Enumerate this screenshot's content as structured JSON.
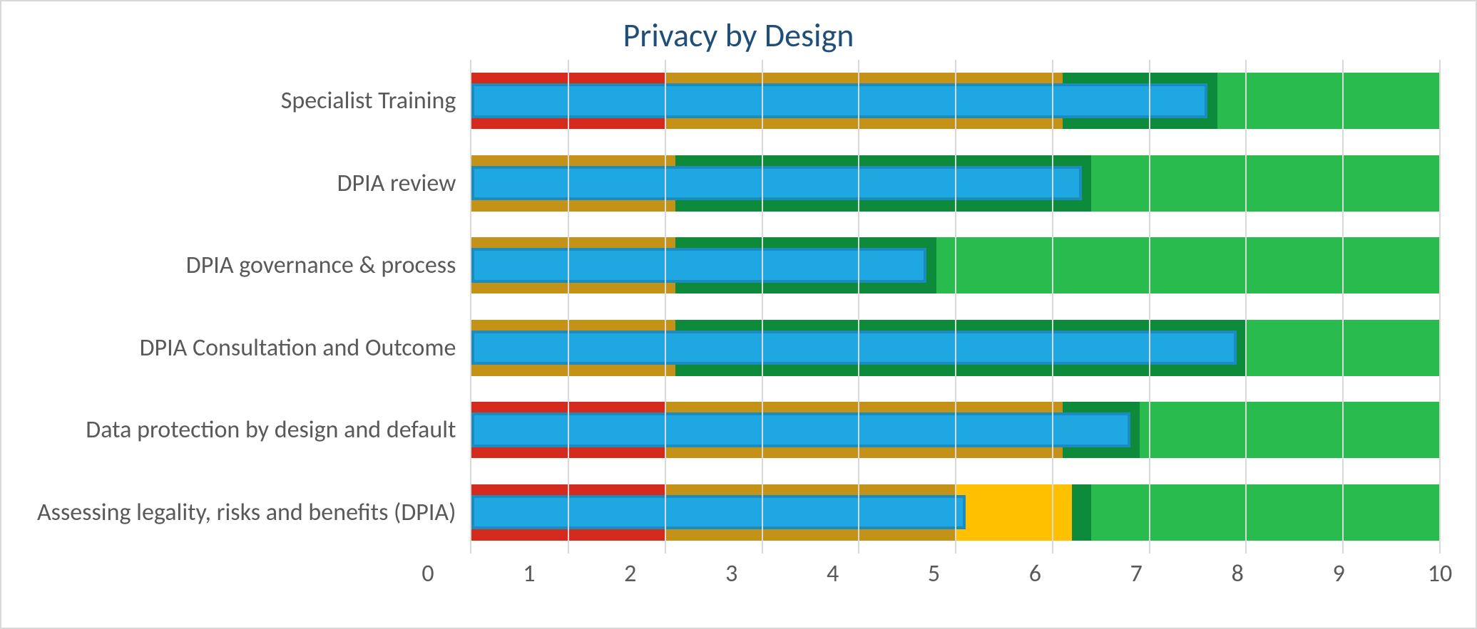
{
  "chart_data": {
    "type": "bar",
    "orientation": "horizontal",
    "title": "Privacy by Design",
    "xlabel": "",
    "ylabel": "",
    "xlim": [
      0,
      10
    ],
    "x_ticks": [
      0,
      1,
      2,
      3,
      4,
      5,
      6,
      7,
      8,
      9,
      10
    ],
    "categories": [
      "Specialist Training",
      "DPIA review",
      "DPIA governance & process",
      "DPIA Consultation and Outcome",
      "Data protection by design and default",
      "Assessing  legality, risks and benefits (DPIA)"
    ],
    "series": [
      {
        "name": "score",
        "values": [
          7.6,
          6.3,
          4.7,
          7.9,
          6.8,
          5.1
        ]
      },
      {
        "name": "zone_red_end",
        "values": [
          2.0,
          0.0,
          0.0,
          0.0,
          2.0,
          2.0
        ]
      },
      {
        "name": "zone_gold_end",
        "values": [
          6.1,
          2.1,
          2.1,
          2.1,
          6.1,
          5.0
        ]
      },
      {
        "name": "zone_yellow_end",
        "values": [
          6.1,
          2.1,
          2.1,
          2.1,
          6.1,
          6.2
        ]
      },
      {
        "name": "zone_dkgrn_end",
        "values": [
          7.7,
          6.4,
          4.8,
          8.0,
          6.9,
          6.4
        ]
      },
      {
        "name": "zone_green_end",
        "values": [
          10.0,
          10.0,
          10.0,
          10.0,
          10.0,
          10.0
        ]
      }
    ],
    "colors": {
      "score_fill": "#1ea7e1",
      "score_border": "#1a8cc0",
      "red": "#d52b1e",
      "gold": "#c39217",
      "yellow": "#ffc000",
      "dkgreen": "#0e8a3b",
      "green": "#2abb4f",
      "title": "#1f4e79",
      "axis": "#595959",
      "grid": "#d9d9d9"
    }
  }
}
